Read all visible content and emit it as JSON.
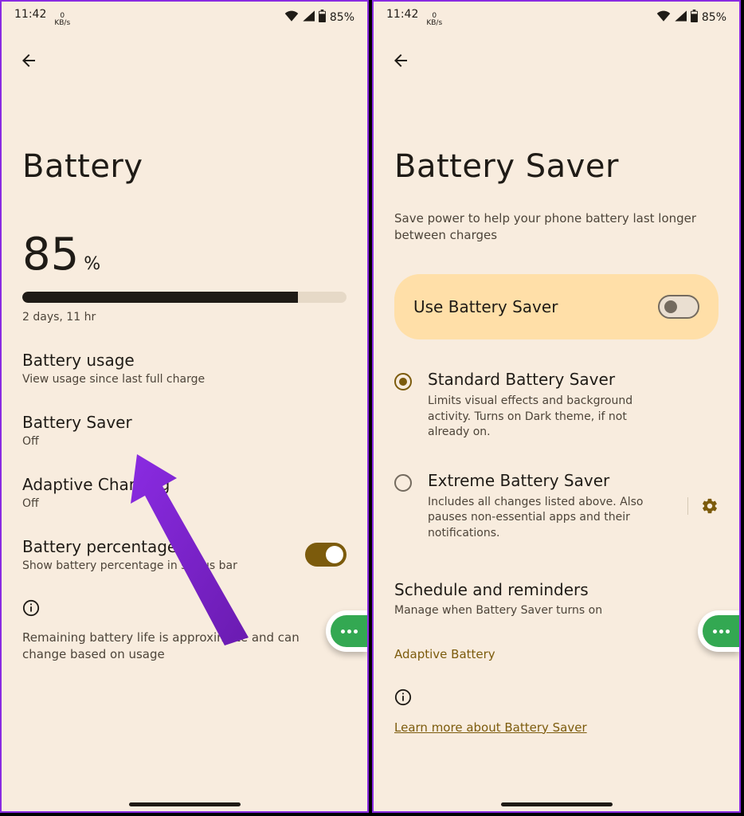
{
  "status": {
    "time": "11:42",
    "net_rate": "0",
    "net_unit": "KB/s",
    "battery_pct": "85%"
  },
  "screen1": {
    "title": "Battery",
    "pct_value": "85",
    "pct_symbol": "%",
    "pct_bar_fill": 85,
    "estimate": "2 days, 11 hr",
    "items": {
      "usage": {
        "title": "Battery usage",
        "sub": "View usage since last full charge"
      },
      "saver": {
        "title": "Battery Saver",
        "sub": "Off"
      },
      "adapt": {
        "title": "Adaptive Charging",
        "sub": "Off"
      },
      "pct": {
        "title": "Battery percentage",
        "sub": "Show battery percentage in status bar",
        "toggled_on": true
      }
    },
    "footer": "Remaining battery life is approximate and can change based on usage"
  },
  "screen2": {
    "title": "Battery Saver",
    "desc": "Save power to help your phone battery last longer between charges",
    "use_card": {
      "label": "Use Battery Saver",
      "toggled_on": false
    },
    "modes": {
      "standard": {
        "title": "Standard Battery Saver",
        "sub": "Limits visual effects and background activity. Turns on Dark theme, if not already on.",
        "selected": true
      },
      "extreme": {
        "title": "Extreme Battery Saver",
        "sub": "Includes all changes listed above. Also pauses non-essential apps and their notifications.",
        "selected": false
      }
    },
    "schedule": {
      "title": "Schedule and reminders",
      "sub": "Manage when Battery Saver turns on"
    },
    "adaptive_link": "Adaptive Battery",
    "learn_link": "Learn more about Battery Saver"
  }
}
